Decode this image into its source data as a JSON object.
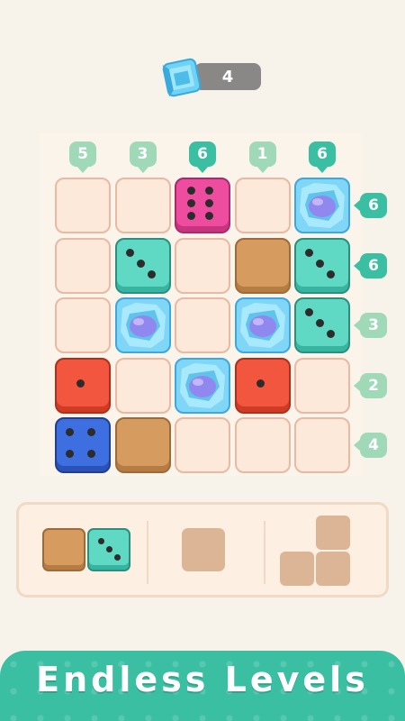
{
  "gem_counter": {
    "value": "4",
    "icon": "gem-icon"
  },
  "column_hints": [
    {
      "value": "5",
      "active": false
    },
    {
      "value": "3",
      "active": false
    },
    {
      "value": "6",
      "active": true
    },
    {
      "value": "1",
      "active": false
    },
    {
      "value": "6",
      "active": true
    }
  ],
  "row_hints": [
    {
      "value": "6",
      "active": true
    },
    {
      "value": "6",
      "active": true
    },
    {
      "value": "3",
      "active": false
    },
    {
      "value": "2",
      "active": false
    },
    {
      "value": "4",
      "active": false
    }
  ],
  "grid": [
    [
      "empty",
      "empty",
      "dice-pink-6",
      "empty",
      "gem"
    ],
    [
      "empty",
      "dice-teal-3",
      "empty",
      "brown",
      "dice-teal-3"
    ],
    [
      "empty",
      "gem",
      "empty",
      "gem",
      "dice-teal-3"
    ],
    [
      "dice-red-1",
      "empty",
      "gem",
      "dice-red-1",
      "empty"
    ],
    [
      "dice-blue-4",
      "brown",
      "empty",
      "empty",
      "empty"
    ]
  ],
  "tray": [
    {
      "piece": "brown-and-dice-teal-3"
    },
    {
      "piece": "single-block"
    },
    {
      "piece": "l-shape-block"
    }
  ],
  "footer": {
    "title": "Endless Levels"
  },
  "colors": {
    "active_hint": "#3bbfa3",
    "inactive_hint": "#9fd9b8",
    "pink": "#ee4d9f",
    "teal": "#5fd8c4",
    "red": "#f2563e",
    "blue": "#3e6fe0",
    "brown": "#d69c5f",
    "empty_cell": "#fde9d9"
  }
}
